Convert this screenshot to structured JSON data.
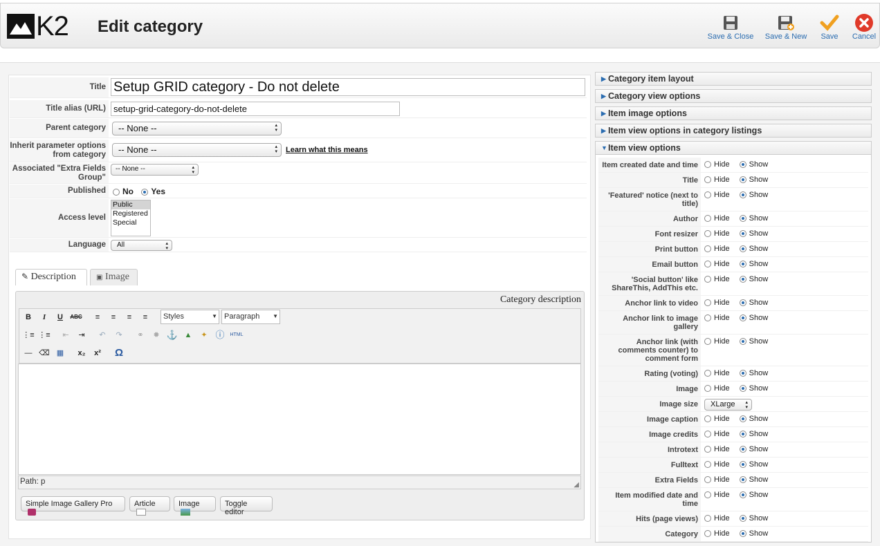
{
  "app": {
    "logo": "K2",
    "title": "Edit category"
  },
  "toolbar": [
    {
      "label": "Save & Close",
      "icon": "floppy-icon"
    },
    {
      "label": "Save & New",
      "icon": "floppy-plus-icon"
    },
    {
      "label": "Save",
      "icon": "checkmark-icon"
    },
    {
      "label": "Cancel",
      "icon": "cancel-icon"
    }
  ],
  "form": {
    "title_label": "Title",
    "title_value": "Setup GRID category - Do not delete",
    "alias_label": "Title alias (URL)",
    "alias_value": "setup-grid-category-do-not-delete",
    "parent_label": "Parent category",
    "parent_value": "-- None --",
    "inherit_label": "Inherit parameter options from category",
    "inherit_value": "-- None --",
    "inherit_link": "Learn what this means",
    "extra_label": "Associated \"Extra Fields Group\"",
    "extra_value": "-- None --",
    "published_label": "Published",
    "published_no": "No",
    "published_yes": "Yes",
    "access_label": "Access level",
    "access_options": [
      "Public",
      "Registered",
      "Special"
    ],
    "language_label": "Language",
    "language_value": "All"
  },
  "tabs": [
    "Description",
    "Image"
  ],
  "editor": {
    "header": "Category description",
    "styles": "Styles",
    "paragraph": "Paragraph",
    "path": "Path: p",
    "html": "HTML",
    "buttons": [
      "Simple Image Gallery Pro",
      "Article",
      "Image",
      "Toggle editor"
    ]
  },
  "accordion": [
    "Category item layout",
    "Category view options",
    "Item image options",
    "Item view options in category listings",
    "Item view options"
  ],
  "options": {
    "hide": "Hide",
    "show": "Show",
    "image_size_value": "XLarge",
    "rows": [
      "Item created date and time",
      "Title",
      "'Featured' notice (next to title)",
      "Author",
      "Font resizer",
      "Print button",
      "Email button",
      "'Social button' like ShareThis, AddThis etc.",
      "Anchor link to video",
      "Anchor link to image gallery",
      "Anchor link (with comments counter) to comment form",
      "Rating (voting)",
      "Image",
      "Image size",
      "Image caption",
      "Image credits",
      "Introtext",
      "Fulltext",
      "Extra Fields",
      "Item modified date and time",
      "Hits (page views)",
      "Category"
    ]
  }
}
